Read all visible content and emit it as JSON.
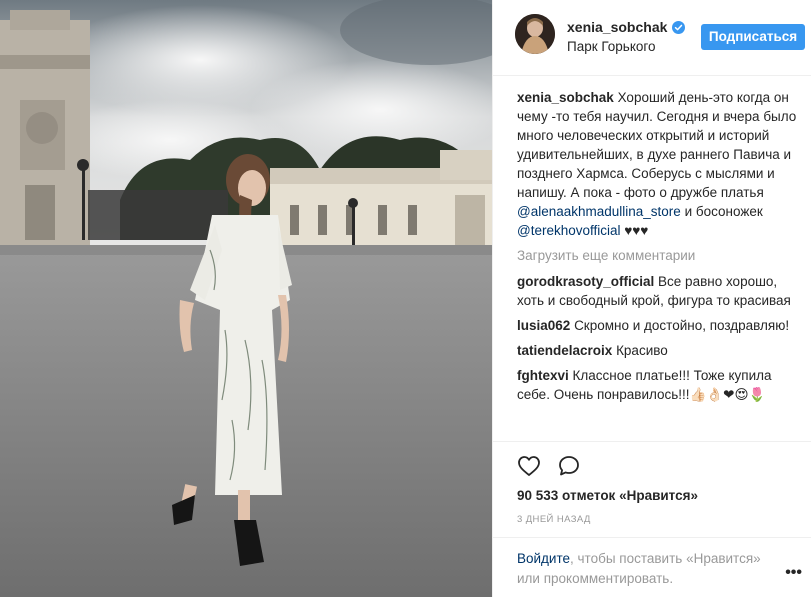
{
  "header": {
    "username": "xenia_sobchak",
    "location": "Парк Горького",
    "follow_label": "Подписаться"
  },
  "caption": {
    "username": "xenia_sobchak",
    "text": "Хороший день-это когда он чему -то тебя научил. Сегодня и вчера было много человеческих открытий и историй удивительнейших, в духе раннего Павича и позднего Хармса. Соберусь с мыслями и напишу. А пока - фото о дружбе платья ",
    "mention1": "@alenaakhmadullina_store",
    "text2": " и босоножек ",
    "mention2": "@terekhovofficial",
    "text3": " ♥♥♥"
  },
  "load_more_label": "Загрузить еще комментарии",
  "comments": [
    {
      "user": "gorodkrasoty_official",
      "text": "Все равно хорошо, хоть и свободный крой, фигура то красивая"
    },
    {
      "user": "lusia062",
      "text": "Скромно и достойно, поздравляю!"
    },
    {
      "user": "tatiendelacroix",
      "text": "Красиво"
    },
    {
      "user": "fghtexvi",
      "text": "Классное платье!!! Тоже купила себе. Очень понравилось!!!👍🏻👌🏻❤😍🌷"
    }
  ],
  "likes_label": "90 533 отметок «Нравится»",
  "time_label": "3 дней назад",
  "footer": {
    "login_link": "Войдите",
    "login_text": ", чтобы поставить «Нравится» или прокомментировать.",
    "more_label": "•••"
  },
  "icons": {
    "like": "heart-outline-icon",
    "comment": "speech-bubble-icon",
    "verified": "verified-badge-icon",
    "more": "ellipsis-icon"
  },
  "colors": {
    "follow_button": "#3897f0",
    "link": "#003569",
    "muted": "#999999",
    "verified": "#3897f0"
  }
}
